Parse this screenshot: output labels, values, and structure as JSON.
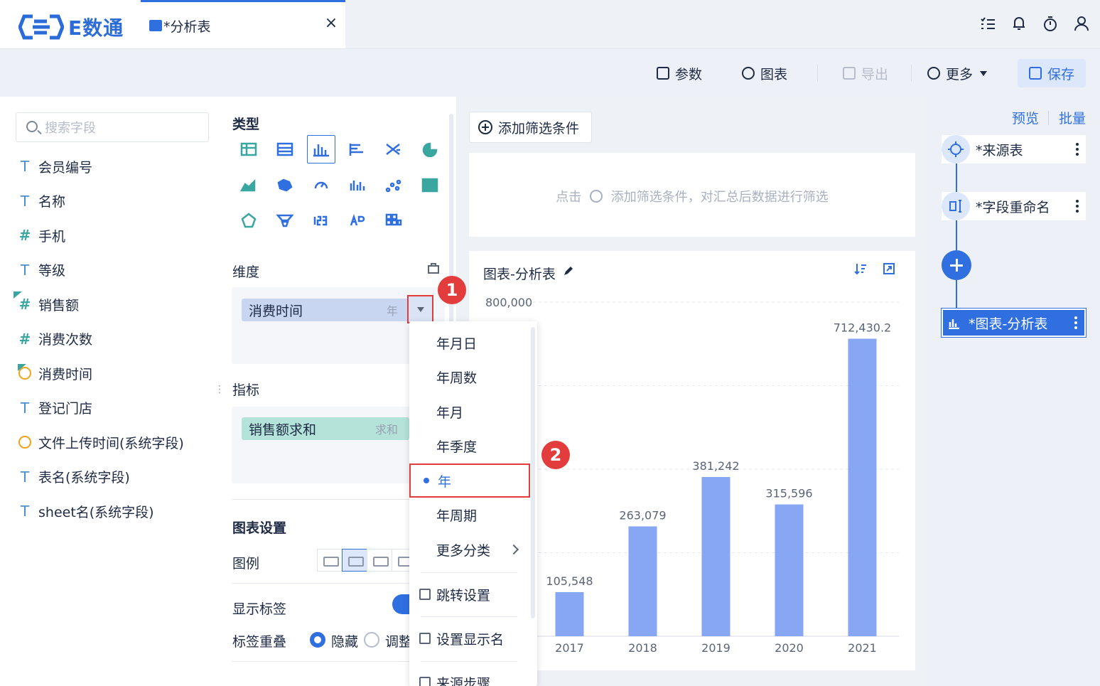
{
  "app": {
    "logo_text": "E数通"
  },
  "tab": {
    "label": "*分析表",
    "close": "×"
  },
  "top_icons": [
    "list-check-icon",
    "bell-icon",
    "timer-icon",
    "user-icon"
  ],
  "toolbar": {
    "params": "参数",
    "chart": "图表",
    "export": "导出",
    "more": "更多",
    "save": "保存"
  },
  "fields": {
    "search_placeholder": "搜索字段",
    "items": [
      {
        "type": "text",
        "label": "会员编号"
      },
      {
        "type": "text",
        "label": "名称"
      },
      {
        "type": "number",
        "label": "手机"
      },
      {
        "type": "text",
        "label": "等级"
      },
      {
        "type": "number-calc",
        "label": "销售额"
      },
      {
        "type": "number",
        "label": "消费次数"
      },
      {
        "type": "date-calc",
        "label": "消费时间"
      },
      {
        "type": "text",
        "label": "登记门店"
      },
      {
        "type": "date",
        "label": "文件上传时间(系统字段)"
      },
      {
        "type": "text",
        "label": "表名(系统字段)"
      },
      {
        "type": "text",
        "label": "sheet名(系统字段)"
      }
    ]
  },
  "config": {
    "type_title": "类型",
    "dimension_title": "维度",
    "dimension_pill": "消费时间",
    "dimension_suffix": "年",
    "indicator_title": "指标",
    "indicator_pill": "销售额求和",
    "indicator_suffix": "求和",
    "chart_settings_title": "图表设置",
    "legend_label": "图例",
    "show_label": "显示标签",
    "overlap_label": "标签重叠",
    "overlap_hide": "隐藏",
    "overlap_adjust": "调整"
  },
  "markers": {
    "one": "1",
    "two": "2"
  },
  "filter": {
    "add_button": "添加筛选条件",
    "hint_prefix": "点击",
    "hint_suffix": "添加筛选条件，对汇总后数据进行筛选"
  },
  "chart_card": {
    "title": "图表-分析表"
  },
  "chart_data": {
    "type": "bar",
    "categories": [
      "2017",
      "2018",
      "2019",
      "2020",
      "2021"
    ],
    "values": [
      105548,
      263079,
      381242,
      315596,
      712430.2
    ],
    "labels": [
      "105,548",
      "263,079",
      "381,242",
      "315,596",
      "712,430.2"
    ],
    "ylim": [
      0,
      800000
    ],
    "ytick_label": "800,000",
    "color": "#87a6f3",
    "grid": true
  },
  "menu": {
    "items": [
      "年月日",
      "年周数",
      "年月",
      "年季度",
      "年",
      "年周期",
      "更多分类"
    ],
    "selected": "年",
    "actions": [
      "跳转设置",
      "设置显示名",
      "来源步骤"
    ]
  },
  "steps": {
    "preview": "预览",
    "batch": "批量",
    "items": [
      "*来源表",
      "*字段重命名",
      "*图表-分析表"
    ]
  },
  "colors": {
    "accent": "#2f6fe0",
    "highlight": "#e23c3c",
    "bar": "#87a6f3"
  }
}
